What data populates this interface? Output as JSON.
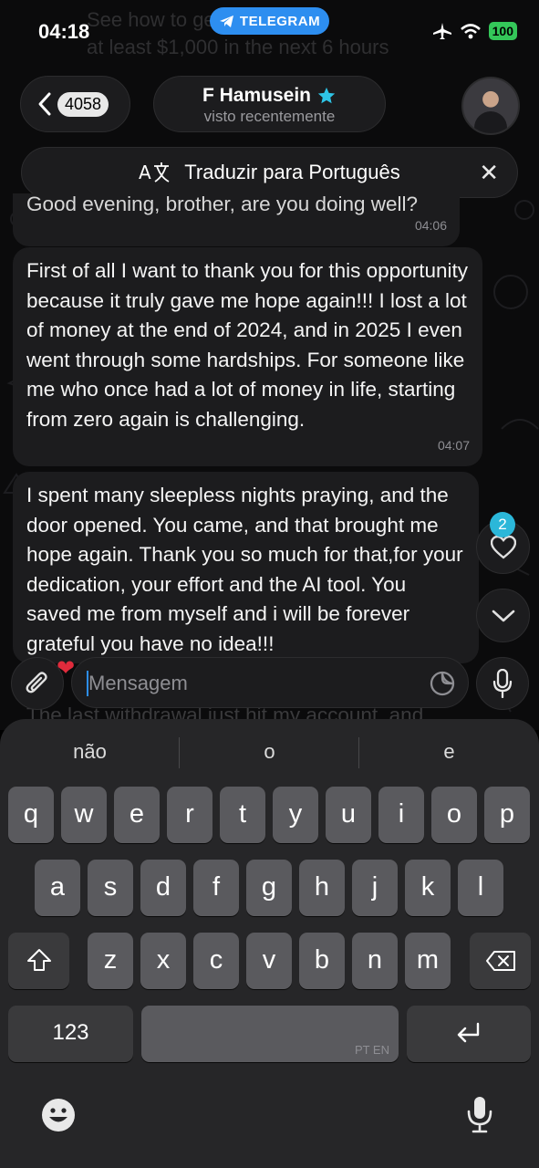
{
  "status_bar": {
    "time": "04:18",
    "app_pill": "TELEGRAM",
    "battery": "100"
  },
  "behind_text": {
    "line1": "See how to get access to",
    "line2": "at least $1,000 in the next 6 hours"
  },
  "header": {
    "back_count": "4058",
    "contact_name": "F Hamusein",
    "contact_status": "visto recentemente"
  },
  "translate_bar": {
    "label": "Traduzir para Português"
  },
  "messages": [
    {
      "text": "Good evening, brother, are you doing well?",
      "time": "04:06"
    },
    {
      "text": "First of all I want to thank you for this opportunity because it truly gave me hope again!!! I lost a lot of money at the end of 2024, and in 2025 I even went through some hardships. For someone like me who once had a lot of money in life, starting from zero again is challenging.",
      "time": "04:07"
    },
    {
      "text": "I spent many sleepless nights praying, and the door opened. You came, and that brought me hope again. Thank you so much for that,for your dedication, your effort and the AI tool. You saved me from myself and i will be forever grateful you have no idea!!!",
      "time": ""
    },
    {
      "text": "The last withdrawal just hit my account, and"
    }
  ],
  "reactions": {
    "count": "2"
  },
  "composer": {
    "placeholder": "Mensagem"
  },
  "keyboard": {
    "suggestions": [
      "não",
      "o",
      "e"
    ],
    "row1": [
      "q",
      "w",
      "e",
      "r",
      "t",
      "y",
      "u",
      "i",
      "o",
      "p"
    ],
    "row2": [
      "a",
      "s",
      "d",
      "f",
      "g",
      "h",
      "j",
      "k",
      "l"
    ],
    "row3": [
      "z",
      "x",
      "c",
      "v",
      "b",
      "n",
      "m"
    ],
    "numbers_key": "123",
    "language_hint": "PT EN"
  }
}
